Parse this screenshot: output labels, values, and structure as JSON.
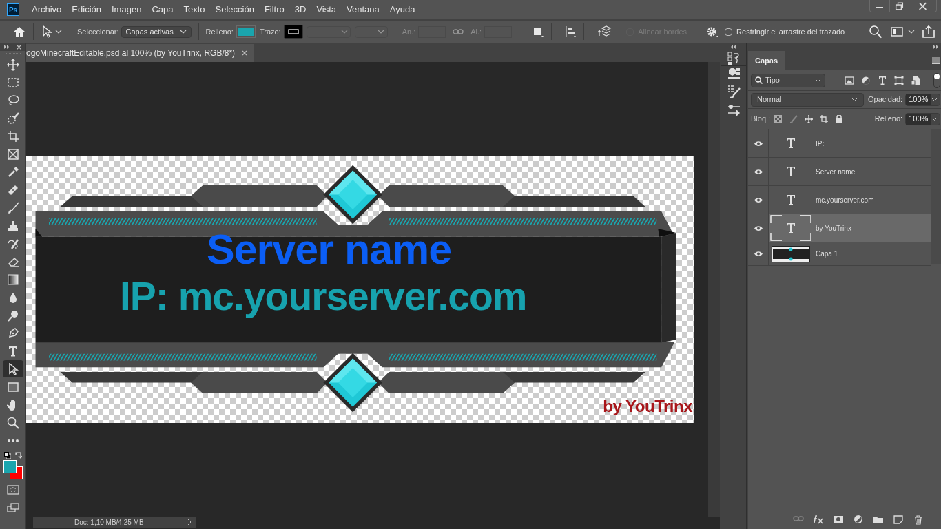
{
  "app_icon": "Ps",
  "menu": [
    "Archivo",
    "Edición",
    "Imagen",
    "Capa",
    "Texto",
    "Selección",
    "Filtro",
    "3D",
    "Vista",
    "Ventana",
    "Ayuda"
  ],
  "options_bar": {
    "select_label": "Seleccionar:",
    "select_value": "Capas activas",
    "fill_label": "Relleno:",
    "stroke_label": "Trazo:",
    "width_label": "An.:",
    "height_label": "Al.:",
    "align_edges": {
      "label": "Alinear bordes",
      "checked": false,
      "disabled": true
    },
    "constrain": {
      "label": "Restringir el arrastre del trazado",
      "checked": false,
      "disabled": false
    }
  },
  "document_tab": {
    "title": "ogoMinecraftEditable.psd al 100% (by YouTrinx, RGB/8*)"
  },
  "tools": [
    {
      "kind": "move",
      "selected": false
    },
    {
      "kind": "marquee",
      "selected": false
    },
    {
      "kind": "lasso",
      "selected": false
    },
    {
      "kind": "quick-select",
      "selected": false
    },
    {
      "kind": "crop",
      "selected": false
    },
    {
      "kind": "frame",
      "selected": false
    },
    {
      "kind": "eyedropper",
      "selected": false
    },
    {
      "kind": "healing",
      "selected": false
    },
    {
      "kind": "brush",
      "selected": false
    },
    {
      "kind": "stamp",
      "selected": false
    },
    {
      "kind": "history-brush",
      "selected": false
    },
    {
      "kind": "eraser",
      "selected": false
    },
    {
      "kind": "gradient",
      "selected": false
    },
    {
      "kind": "blur",
      "selected": false
    },
    {
      "kind": "dodge",
      "selected": false
    },
    {
      "kind": "pen",
      "selected": false
    },
    {
      "kind": "type",
      "selected": false
    },
    {
      "kind": "path-select",
      "selected": true
    },
    {
      "kind": "rectangle",
      "selected": false
    },
    {
      "kind": "hand",
      "selected": false
    },
    {
      "kind": "zoom",
      "selected": false
    },
    {
      "kind": "more",
      "selected": false
    }
  ],
  "canvas": {
    "title": "Server name",
    "subtitle": "IP: mc.yourserver.com",
    "credit": "by YouTrinx"
  },
  "status_bar": {
    "doc": "Doc: 1,10 MB/4,25 MB"
  },
  "layers_panel": {
    "tab": "Capas",
    "filter": "Tipo",
    "filter_on": true,
    "blend_mode": "Normal",
    "opacity_label": "Opacidad:",
    "opacity": "100%",
    "lock_label": "Bloq.:",
    "fill_label": "Relleno:",
    "fill": "100%",
    "layers": [
      {
        "name": "IP:",
        "kind": "text",
        "visible": true,
        "selected": false
      },
      {
        "name": "Server name",
        "kind": "text",
        "visible": true,
        "selected": false
      },
      {
        "name": "mc.yourserver.com",
        "kind": "text",
        "visible": true,
        "selected": false
      },
      {
        "name": "by YouTrinx",
        "kind": "text",
        "visible": true,
        "selected": true
      },
      {
        "name": "Capa 1",
        "kind": "image",
        "visible": true,
        "selected": false
      }
    ]
  }
}
